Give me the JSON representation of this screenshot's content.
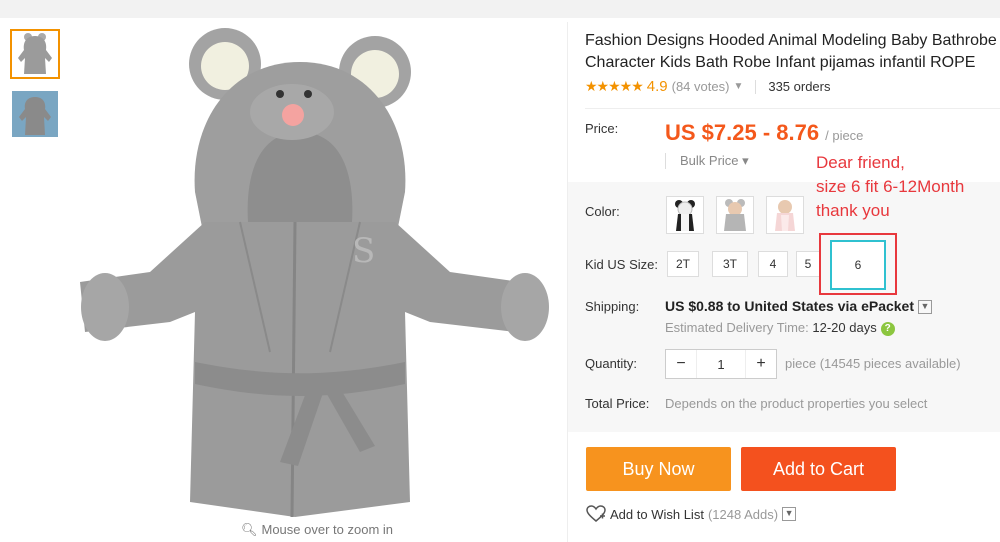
{
  "product": {
    "title_line1": "Fashion Designs Hooded Animal Modeling Baby Bathrobe",
    "title_line2": "Character Kids Bath Robe Infant pijamas infantil ROPE",
    "stars": "★★★★★",
    "rating": "4.9",
    "votes": "(84 votes)",
    "orders": "335 orders"
  },
  "price": {
    "label": "Price:",
    "value": "US $7.25 - 8.76",
    "unit": "/ piece",
    "bulk": "Bulk Price ▾"
  },
  "color": {
    "label": "Color:"
  },
  "size": {
    "label": "Kid US Size:",
    "options": [
      "2T",
      "3T",
      "4",
      "5",
      "6"
    ],
    "selected": "6"
  },
  "note": {
    "line1": "Dear friend,",
    "line2": "size 6 fit 6-12Month",
    "line3": "thank you"
  },
  "shipping": {
    "label": "Shipping:",
    "cost": "US $0.88",
    "to": " to ",
    "destination": "United States via ePacket",
    "delivery_label": "Estimated Delivery Time: ",
    "delivery_days": "12-20 days"
  },
  "quantity": {
    "label": "Quantity:",
    "minus": "−",
    "value": "1",
    "plus": "+",
    "available": "piece (14545 pieces available)"
  },
  "total": {
    "label": "Total Price:",
    "note": "Depends on the product properties you select"
  },
  "actions": {
    "buy_now": "Buy Now",
    "add_to_cart": "Add to Cart",
    "wish_label": "Add to Wish List",
    "wish_adds": "(1248 Adds)"
  },
  "gallery": {
    "zoom_hint": "Mouse over to zoom in"
  },
  "colors": {
    "accent_orange": "#f39200",
    "price_red": "#f4581b",
    "buy_button": "#f7931e",
    "cart_button": "#f4511e",
    "annotation_red": "#e8383d",
    "selected_cyan": "#2fc1d0",
    "robe_gray": "#9b9b9b"
  }
}
